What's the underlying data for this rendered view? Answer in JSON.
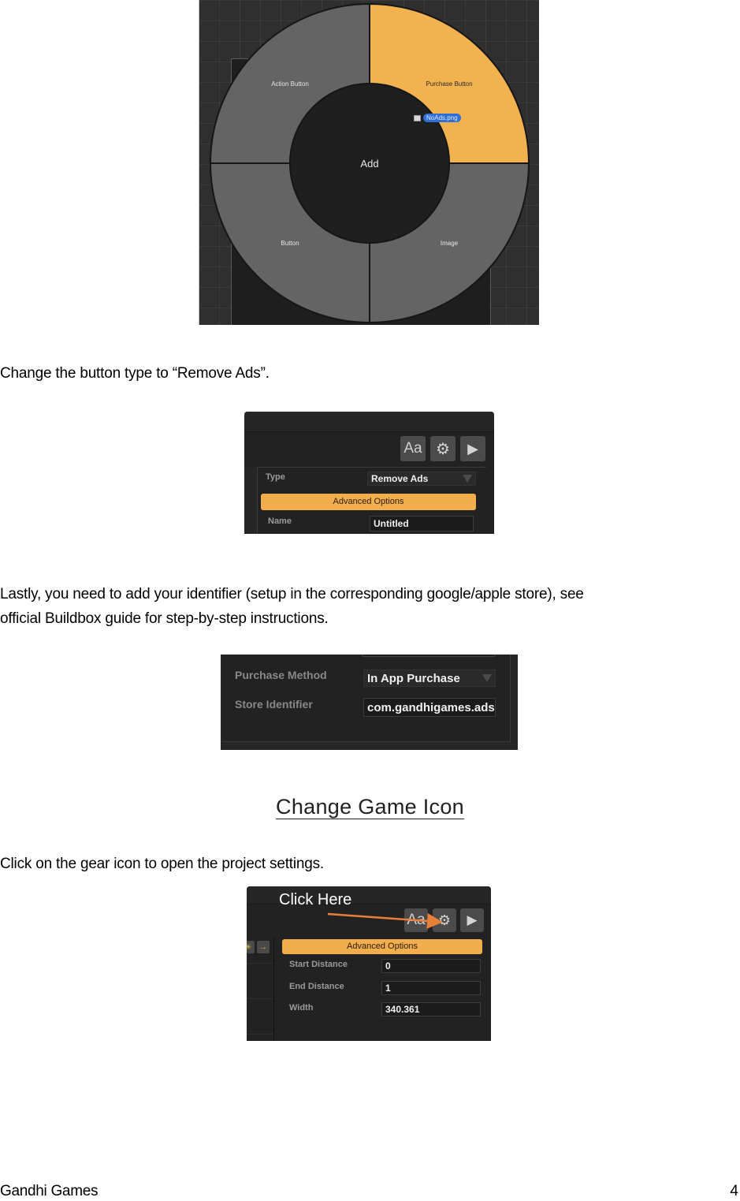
{
  "radial_menu": {
    "center_label": "Add",
    "segments": [
      {
        "label": "Action Button",
        "position": "top-left",
        "selected": false
      },
      {
        "label": "Purchase Button",
        "position": "top-right",
        "selected": true
      },
      {
        "label": "Button",
        "position": "bottom-left",
        "selected": false
      },
      {
        "label": "Image",
        "position": "bottom-right",
        "selected": false
      }
    ],
    "drag_file": "NoAds.png",
    "colors": {
      "selected": "#f2b250",
      "segment": "#646464",
      "center": "#1f1f1f"
    }
  },
  "step_text_1": "Change the button type to “Remove Ads”.",
  "panel_type": {
    "toolbar": {
      "font_button": "Aa",
      "settings_icon": "gear-icon",
      "play_icon": "play-icon"
    },
    "type_label": "Type",
    "type_value": "Remove Ads",
    "advanced_options": "Advanced Options",
    "name_label": "Name",
    "name_value": "Untitled"
  },
  "step_text_2_line1": "Lastly, you need to add your identifier (setup in the corresponding google/apple store), see",
  "step_text_2_line2": "official Buildbox guide for step-by-step instructions.",
  "panel_store": {
    "purchase_method_label": "Purchase Method",
    "purchase_method_value": "In App Purchase",
    "store_identifier_label": "Store Identifier",
    "store_identifier_value": "com.gandhigames.ads"
  },
  "section_heading": "Change Game Icon",
  "step_text_3": "Click on the gear icon to open the project settings.",
  "panel_settings": {
    "callout": "Click Here",
    "toolbar": {
      "font_button": "Aa",
      "settings_icon": "gear-icon",
      "play_icon": "play-icon"
    },
    "advanced_options": "Advanced Options",
    "fields": [
      {
        "label": "Start Distance",
        "value": "0"
      },
      {
        "label": "End Distance",
        "value": "1"
      },
      {
        "label": "Width",
        "value": "340.361"
      }
    ],
    "accent": "#f2ad4d",
    "arrow_color": "#e8803a"
  },
  "footer": {
    "left": "Gandhi Games",
    "page_number": "4"
  }
}
